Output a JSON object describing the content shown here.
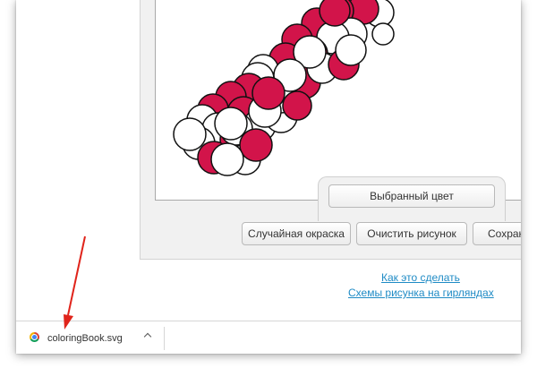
{
  "app": {
    "selected_color_label": "Выбранный цвет",
    "buttons": {
      "random_coloring": "Случайная окраска",
      "clear_drawing": "Очистить рисунок",
      "save": "Сохрани"
    }
  },
  "links": {
    "how_to": "Как это сделать",
    "schemes": "Схемы рисунка на гирляндах"
  },
  "download_bar": {
    "file_name": "coloringBook.svg",
    "icon": "chrome-icon"
  },
  "colors": {
    "balloon_red": "#d2144a",
    "balloon_white": "#ffffff",
    "link": "#1f8bc5",
    "annotation_arrow": "#e0241b"
  }
}
